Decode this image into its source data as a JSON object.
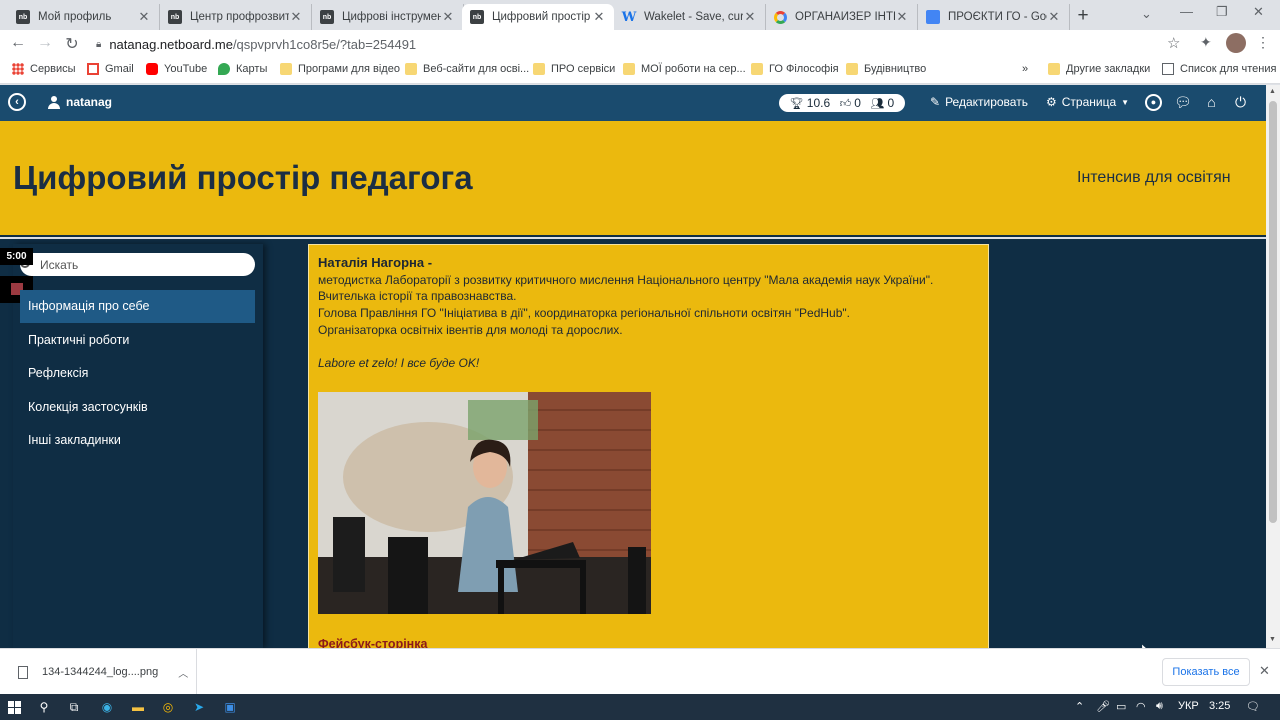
{
  "browser": {
    "tabs": [
      {
        "title": "Мой профиль",
        "fav": "nb"
      },
      {
        "title": "Центр профрозвитку",
        "fav": "nb"
      },
      {
        "title": "Цифрові інструменти",
        "fav": "nb"
      },
      {
        "title": "Цифровий простір педагога",
        "fav": "nb",
        "active": true
      },
      {
        "title": "Wakelet - Save, curate",
        "fav": "wk"
      },
      {
        "title": "ОРГАНАЙЗЕР ІНТЕНСИВ",
        "fav": "gg"
      },
      {
        "title": "ПРОЄКТИ ГО - Google",
        "fav": "doc"
      }
    ],
    "url_host": "natanag.netboard.me",
    "url_path": "/qspvprvh1co8r5e/?tab=254491",
    "bookmarks": [
      {
        "label": "Сервисы",
        "icon": "apps-icon"
      },
      {
        "label": "Gmail",
        "icon": "gmail-icon"
      },
      {
        "label": "YouTube",
        "icon": "youtube-icon"
      },
      {
        "label": "Карты",
        "icon": "maps-icon"
      },
      {
        "label": "Програми для відео",
        "icon": "folder-icon"
      },
      {
        "label": "Веб-сайти для осві...",
        "icon": "folder-icon"
      },
      {
        "label": "ПРО сервіси",
        "icon": "folder-icon"
      },
      {
        "label": "МОЇ роботи на сер...",
        "icon": "folder-icon"
      },
      {
        "label": "ГО Філософія",
        "icon": "folder-icon"
      },
      {
        "label": "Будівництво",
        "icon": "folder-icon"
      }
    ],
    "bookmarks_more": "»",
    "other_bookmarks": "Другие закладки",
    "reading_list": "Список для чтения"
  },
  "netboard": {
    "username": "natanag",
    "stats": {
      "score": "10.6",
      "likes": "0",
      "followers": "0"
    },
    "edit_label": "Редактировать",
    "page_label": "Страница",
    "title": "Цифровий простір педагога",
    "subtitle": "Інтенсив для освітян",
    "search_placeholder": "Искать",
    "timer": "5:00",
    "menu": [
      {
        "label": "Інформація про себе",
        "active": true
      },
      {
        "label": "Практичні роботи"
      },
      {
        "label": "Рефлексія"
      },
      {
        "label": "Колекція застосунків"
      },
      {
        "label": "Інші закладинки"
      }
    ],
    "content": {
      "name": "Наталія Нагорна -",
      "lines": [
        "методистка Лабораторії з розвитку критичного мислення Національного центру \"Мала академія наук України\".",
        "Вчителька історії та правознавства.",
        "Голова Правління ГО \"Ініціатива в дії\", координаторка регіональної спільноти освітян \"PedHub\".",
        "Організаторка освітніх івентів для молоді та дорослих."
      ],
      "motto": "Labore et zelo! І все буде OK!",
      "facebook_link": "Фейсбук-сторінка"
    }
  },
  "downloads": {
    "file": "134-1344244_log....png",
    "show_all": "Показать все"
  },
  "taskbar": {
    "lang": "УКР",
    "time": "3:25"
  }
}
